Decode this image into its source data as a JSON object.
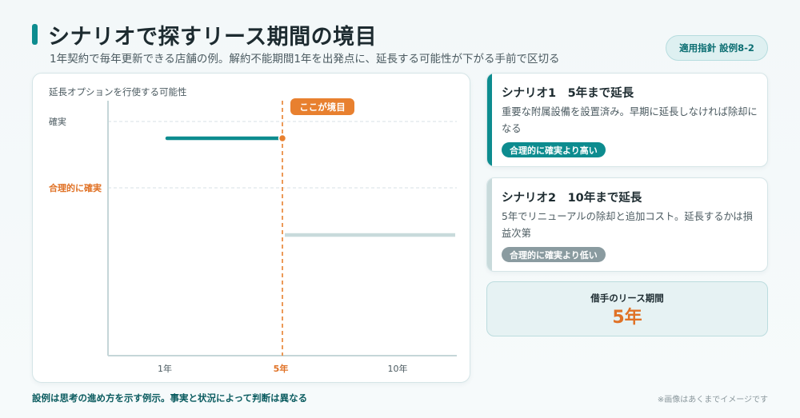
{
  "header": {
    "title": "シナリオで探すリース期間の境目",
    "subtitle": "1年契約で毎年更新できる店舗の例。解約不能期間1年を出発点に、延長する可能性が下がる手前で区切る",
    "badge": "適用指針 設例8-2"
  },
  "chart": {
    "ylabel": "延長オプションを行使する可能性",
    "levels": {
      "high": "確実",
      "mid": "合理的に確実"
    },
    "boundary_label": "ここが境目",
    "x_ticks": [
      "1年",
      "5年",
      "10年"
    ],
    "colors": {
      "teal": "#0d8c8f",
      "orange": "#e8802f",
      "grey": "#c8dadb"
    }
  },
  "chart_data": {
    "type": "line",
    "x_ticks": [
      "1年",
      "5年",
      "10年"
    ],
    "y_levels": [
      "確実",
      "合理的に確実"
    ],
    "series": [
      {
        "segment": "before",
        "x_from": 1,
        "x_to": 5,
        "y": 0.93
      },
      {
        "segment": "after",
        "x_from": 5,
        "x_to": 10,
        "y": 0.5
      }
    ],
    "boundary_x": 5
  },
  "scenarios": [
    {
      "title": "シナリオ1　5年まで延長",
      "text": "重要な附属設備を設置済み。早期に延長しなければ除却になる",
      "pill": "合理的に確実より高い",
      "accent": "#0d8c8f",
      "pill_color": "#0d8c8f"
    },
    {
      "title": "シナリオ2　10年まで延長",
      "text": "5年でリニューアルの除却と追加コスト。延長するかは損益次第",
      "pill": "合理的に確実より低い",
      "accent": "#c8dadb",
      "pill_color": "#8a9ba0"
    }
  ],
  "result": {
    "label": "借手のリース期間",
    "value": "5年"
  },
  "footer": {
    "note": "設例は思考の進め方を示す例示。事実と状況によって判断は異なる",
    "disclaimer": "※画像はあくまでイメージです"
  }
}
